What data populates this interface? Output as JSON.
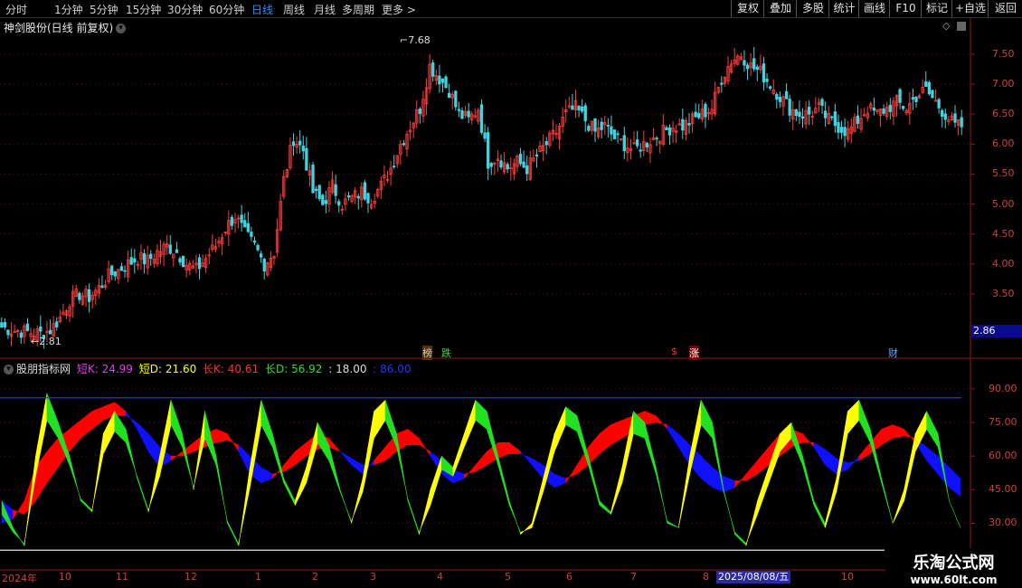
{
  "toolbar": {
    "tabs": [
      {
        "label": "分时",
        "active": false
      },
      {
        "label": "1分钟",
        "active": false
      },
      {
        "label": "5分钟",
        "active": false
      },
      {
        "label": "15分钟",
        "active": false
      },
      {
        "label": "30分钟",
        "active": false
      },
      {
        "label": "60分钟",
        "active": false
      },
      {
        "label": "日线",
        "active": true
      },
      {
        "label": "周线",
        "active": false
      },
      {
        "label": "月线",
        "active": false
      },
      {
        "label": "多周期",
        "active": false
      },
      {
        "label": "更多 >",
        "active": false
      }
    ],
    "buttons": [
      "复权",
      "叠加",
      "多股",
      "统计",
      "画线",
      "F10",
      "标记",
      "+自选",
      "返回"
    ]
  },
  "stock": {
    "title": "神剑股份(日线 前复权)",
    "high_label": "7.68",
    "low_label": "2.81",
    "current_box": "2.86",
    "price_axis": [
      "7.50",
      "7.00",
      "6.50",
      "6.00",
      "5.50",
      "5.00",
      "4.50",
      "4.00",
      "3.50"
    ],
    "badges": [
      {
        "text": "榜",
        "color": "#ff8a00"
      },
      {
        "text": "跌",
        "color": "#33dd33"
      },
      {
        "text": "$",
        "color": "#ff3030"
      },
      {
        "text": "涨",
        "color": "#ff3030"
      },
      {
        "text": "财",
        "color": "#66aaff"
      }
    ]
  },
  "indicator": {
    "name": "股朋指标网",
    "params": [
      {
        "label": "短K: 24.99",
        "color": "#e040e0"
      },
      {
        "label": "短D: 21.60",
        "color": "#ffff00"
      },
      {
        "label": "长K: 40.61",
        "color": "#ff3030"
      },
      {
        "label": "长D: 56.92",
        "color": "#33dd33"
      },
      {
        "label": ": 18.00",
        "color": "#dddddd"
      },
      {
        "label": ": 86.00",
        "color": "#2233ff"
      }
    ],
    "axis": [
      "90.00",
      "75.00",
      "60.00",
      "45.00",
      "30.00"
    ],
    "upper_line": 86,
    "lower_line": 18
  },
  "dates": {
    "labels": [
      "2024年",
      "10",
      "11",
      "12",
      "1",
      "2",
      "3",
      "4",
      "5",
      "6",
      "7",
      "8",
      "10"
    ],
    "cursor_date": "2025/08/08/五"
  },
  "watermark": {
    "line1": "乐淘公式网",
    "line2": "www.60lt.com"
  },
  "colors": {
    "up": "#ff3b3b",
    "down": "#3fd4e0",
    "axis": "#8a1c1c",
    "yellow": "#ffff00",
    "green": "#22e022",
    "red_band": "#ff0000",
    "blue_band": "#1010ff"
  },
  "chart_data": [
    {
      "type": "candlestick",
      "y_axis_ticks": [
        3.5,
        4.0,
        4.5,
        5.0,
        5.5,
        6.0,
        6.5,
        7.0,
        7.5
      ],
      "ylim": [
        2.7,
        7.8
      ],
      "annotations": [
        {
          "label": "7.68",
          "value": 7.68
        },
        {
          "label": "2.81",
          "value": 2.81
        }
      ],
      "close_series_approx": [
        2.95,
        2.9,
        2.88,
        2.86,
        2.84,
        2.9,
        3.1,
        3.4,
        3.5,
        3.45,
        3.6,
        3.8,
        3.9,
        4.0,
        4.1,
        4.05,
        4.2,
        4.3,
        4.2,
        4.0,
        3.9,
        4.1,
        4.3,
        4.6,
        4.8,
        4.5,
        4.3,
        4.0,
        4.2,
        5.4,
        6.1,
        5.9,
        5.2,
        5.0,
        5.3,
        5.0,
        5.1,
        5.2,
        5.1,
        5.3,
        5.6,
        6.0,
        6.3,
        6.6,
        7.3,
        7.1,
        6.9,
        6.5,
        6.4,
        6.6,
        5.7,
        5.8,
        5.6,
        5.7,
        5.6,
        5.8,
        6.0,
        6.2,
        6.5,
        6.6,
        6.4,
        6.2,
        6.3,
        6.1,
        6.0,
        5.9,
        6.0,
        6.1,
        6.2,
        6.3,
        6.3,
        6.4,
        6.5,
        6.6,
        7.1,
        7.4,
        7.5,
        7.3,
        7.2,
        7.0,
        6.8,
        6.6,
        6.5,
        6.5,
        6.6,
        6.4,
        6.3,
        6.2,
        6.4,
        6.6,
        6.5,
        6.6,
        6.7,
        6.6,
        6.8,
        6.9,
        6.7,
        6.5,
        6.3,
        6.3
      ]
    },
    {
      "type": "area",
      "y_axis_ticks": [
        30,
        45,
        60,
        75,
        90
      ],
      "ylim": [
        10,
        98
      ],
      "series": [
        {
          "name": "短K",
          "values": [
            40,
            28,
            20,
            60,
            88,
            75,
            60,
            40,
            35,
            70,
            80,
            72,
            50,
            35,
            60,
            85,
            70,
            45,
            80,
            60,
            30,
            20,
            55,
            85,
            70,
            50,
            40,
            55,
            75,
            65,
            45,
            30,
            50,
            80,
            85,
            70,
            40,
            25,
            45,
            60,
            55,
            70,
            85,
            80,
            60,
            40,
            25,
            30,
            50,
            70,
            82,
            78,
            60,
            40,
            35,
            55,
            80,
            75,
            55,
            30,
            28,
            60,
            85,
            75,
            45,
            25,
            20,
            40,
            55,
            70,
            75,
            60,
            40,
            30,
            50,
            80,
            85,
            72,
            50,
            30,
            45,
            70,
            80,
            70,
            40,
            28
          ]
        },
        {
          "name": "短D",
          "values": [
            38,
            30,
            25,
            55,
            80,
            72,
            60,
            45,
            40,
            65,
            75,
            70,
            55,
            40,
            55,
            78,
            68,
            50,
            72,
            60,
            35,
            25,
            50,
            78,
            68,
            52,
            42,
            52,
            70,
            62,
            48,
            35,
            48,
            72,
            80,
            68,
            45,
            30,
            42,
            58,
            55,
            68,
            80,
            76,
            60,
            42,
            30,
            32,
            48,
            66,
            78,
            75,
            60,
            42,
            38,
            52,
            74,
            72,
            56,
            35,
            32,
            56,
            78,
            72,
            48,
            30,
            25,
            38,
            52,
            66,
            72,
            60,
            42,
            32,
            48,
            74,
            80,
            70,
            52,
            34,
            44,
            66,
            76,
            68,
            44,
            32
          ]
        },
        {
          "name": "长K",
          "values": [
            30,
            32,
            40,
            55,
            62,
            68,
            72,
            76,
            80,
            82,
            84,
            80,
            72,
            62,
            55,
            58,
            62,
            66,
            70,
            72,
            70,
            62,
            52,
            48,
            50,
            56,
            62,
            66,
            70,
            68,
            62,
            56,
            52,
            58,
            64,
            70,
            72,
            68,
            60,
            52,
            48,
            50,
            56,
            62,
            66,
            66,
            62,
            56,
            50,
            46,
            48,
            56,
            64,
            70,
            74,
            76,
            78,
            80,
            78,
            72,
            64,
            56,
            50,
            46,
            44,
            46,
            52,
            58,
            64,
            70,
            72,
            70,
            64,
            56,
            52,
            54,
            60,
            66,
            72,
            74,
            72,
            66,
            58,
            52,
            46,
            42
          ]
        },
        {
          "name": "长D",
          "values": [
            40,
            36,
            34,
            40,
            48,
            55,
            62,
            68,
            72,
            76,
            78,
            78,
            75,
            70,
            64,
            60,
            60,
            62,
            64,
            66,
            67,
            65,
            60,
            55,
            52,
            53,
            56,
            60,
            63,
            64,
            62,
            59,
            56,
            56,
            58,
            62,
            65,
            65,
            62,
            58,
            54,
            52,
            53,
            56,
            59,
            61,
            61,
            59,
            56,
            52,
            50,
            52,
            56,
            61,
            65,
            68,
            71,
            74,
            75,
            74,
            70,
            65,
            60,
            55,
            51,
            49,
            49,
            52,
            56,
            60,
            64,
            66,
            66,
            63,
            59,
            57,
            58,
            61,
            65,
            68,
            69,
            68,
            64,
            60,
            55,
            50
          ]
        }
      ],
      "hlines": [
        18,
        86
      ]
    }
  ]
}
